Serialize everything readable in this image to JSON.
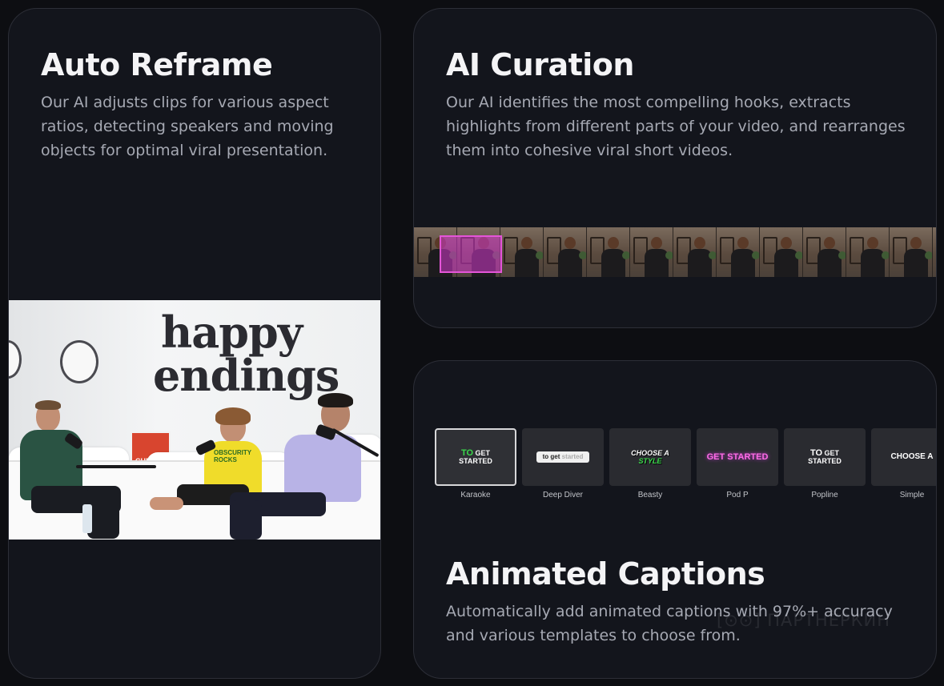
{
  "cards": {
    "reframe": {
      "title": "Auto Reframe",
      "description": "Our AI adjusts clips for various aspect ratios, detecting speakers and moving objects for optimal viral presentation.",
      "scene_text_line1": "happy",
      "scene_text_line2": "endings",
      "poster_text": "CHEAP",
      "shirt_text": "OBSCURITY ROCKS"
    },
    "curation": {
      "title": "AI Curation",
      "description": "Our AI identifies the most compelling hooks, extracts highlights from different parts of your video, and rearranges them into cohesive viral short videos."
    },
    "captions": {
      "title": "Animated Captions",
      "description": "Automatically add animated captions with 97%+ accuracy and various templates to choose from.",
      "watermark": "[⊙⊙] ПАРТНЁРКИН",
      "templates": [
        {
          "name": "Karaoke",
          "preview_a": "TO",
          "preview_b": "GET",
          "preview_c": "STARTED",
          "selected": true
        },
        {
          "name": "Deep Diver",
          "preview_a": "to get",
          "preview_b": "started"
        },
        {
          "name": "Beasty",
          "preview_a": "CHOOSE A",
          "preview_b": "STYLE"
        },
        {
          "name": "Pod P",
          "preview_a": "GET STARTED"
        },
        {
          "name": "Popline",
          "preview_a": "TO",
          "preview_b": "GET",
          "preview_c": "STARTED"
        },
        {
          "name": "Simple",
          "preview_a": "CHOOSE A"
        }
      ]
    }
  },
  "colors": {
    "background": "#0d0e12",
    "card": "#13151c",
    "accent_green": "#3bd84c",
    "accent_pink": "#ff6ce6",
    "highlight_magenta": "#d638ce"
  }
}
